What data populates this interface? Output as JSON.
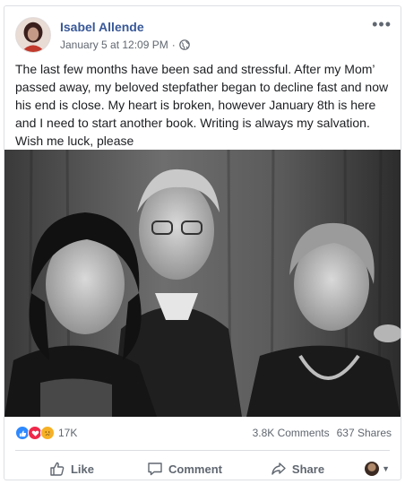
{
  "post": {
    "author": "Isabel Allende",
    "timestamp": "January 5 at 12:09 PM",
    "separator": "·",
    "privacy_icon": "globe-icon",
    "more_icon": "more-icon",
    "more_label": "•••",
    "text": "The last few months have been sad and stressful. After my Mom’ passed away, my beloved stepfather began to decline fast and now his end is close. My heart is broken, however January 8th is here and I need to start another book. Writing is always my salvation. Wish me luck, please"
  },
  "stats": {
    "reaction_icons": [
      "like-icon",
      "love-icon",
      "sad-icon"
    ],
    "reaction_count": "17K",
    "comments": "3.8K Comments",
    "shares": "637 Shares"
  },
  "actions": {
    "like": "Like",
    "comment": "Comment",
    "share": "Share"
  },
  "colors": {
    "author_link": "#385898",
    "secondary_text": "#606770",
    "like_blue": "#2e89ff",
    "love_red": "#f0284a",
    "sad_yellow": "#f7b125"
  }
}
